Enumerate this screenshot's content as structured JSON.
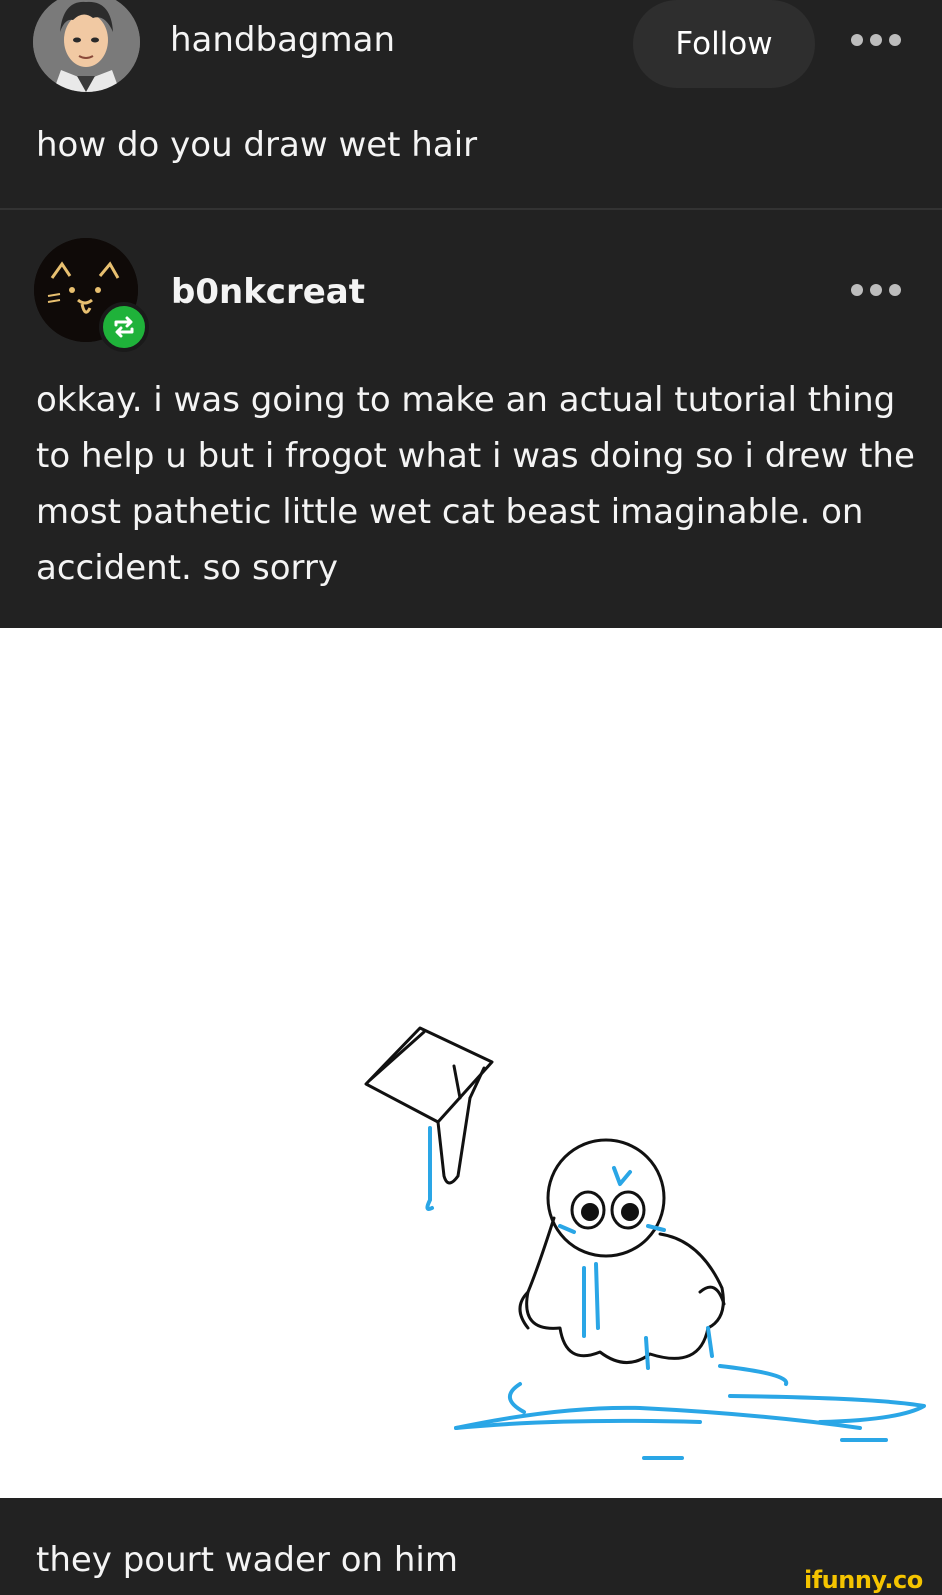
{
  "original_post": {
    "username": "handbagman",
    "follow_label": "Follow",
    "text": "how do you draw wet hair"
  },
  "reblog": {
    "username": "b0nkcreat",
    "text": "okkay. i was  going to make an actual tutorial thing to help u but i frogot what i was doing so i drew the most pathetic little wet cat beast imaginable. on accident. so sorry",
    "caption": "they pourt wader on him"
  },
  "watermark": "ifunny.co",
  "colors": {
    "background": "#222222",
    "reblog_badge": "#1fb23a",
    "drawing_water": "#2aa6e6",
    "watermark": "#f5c400"
  }
}
